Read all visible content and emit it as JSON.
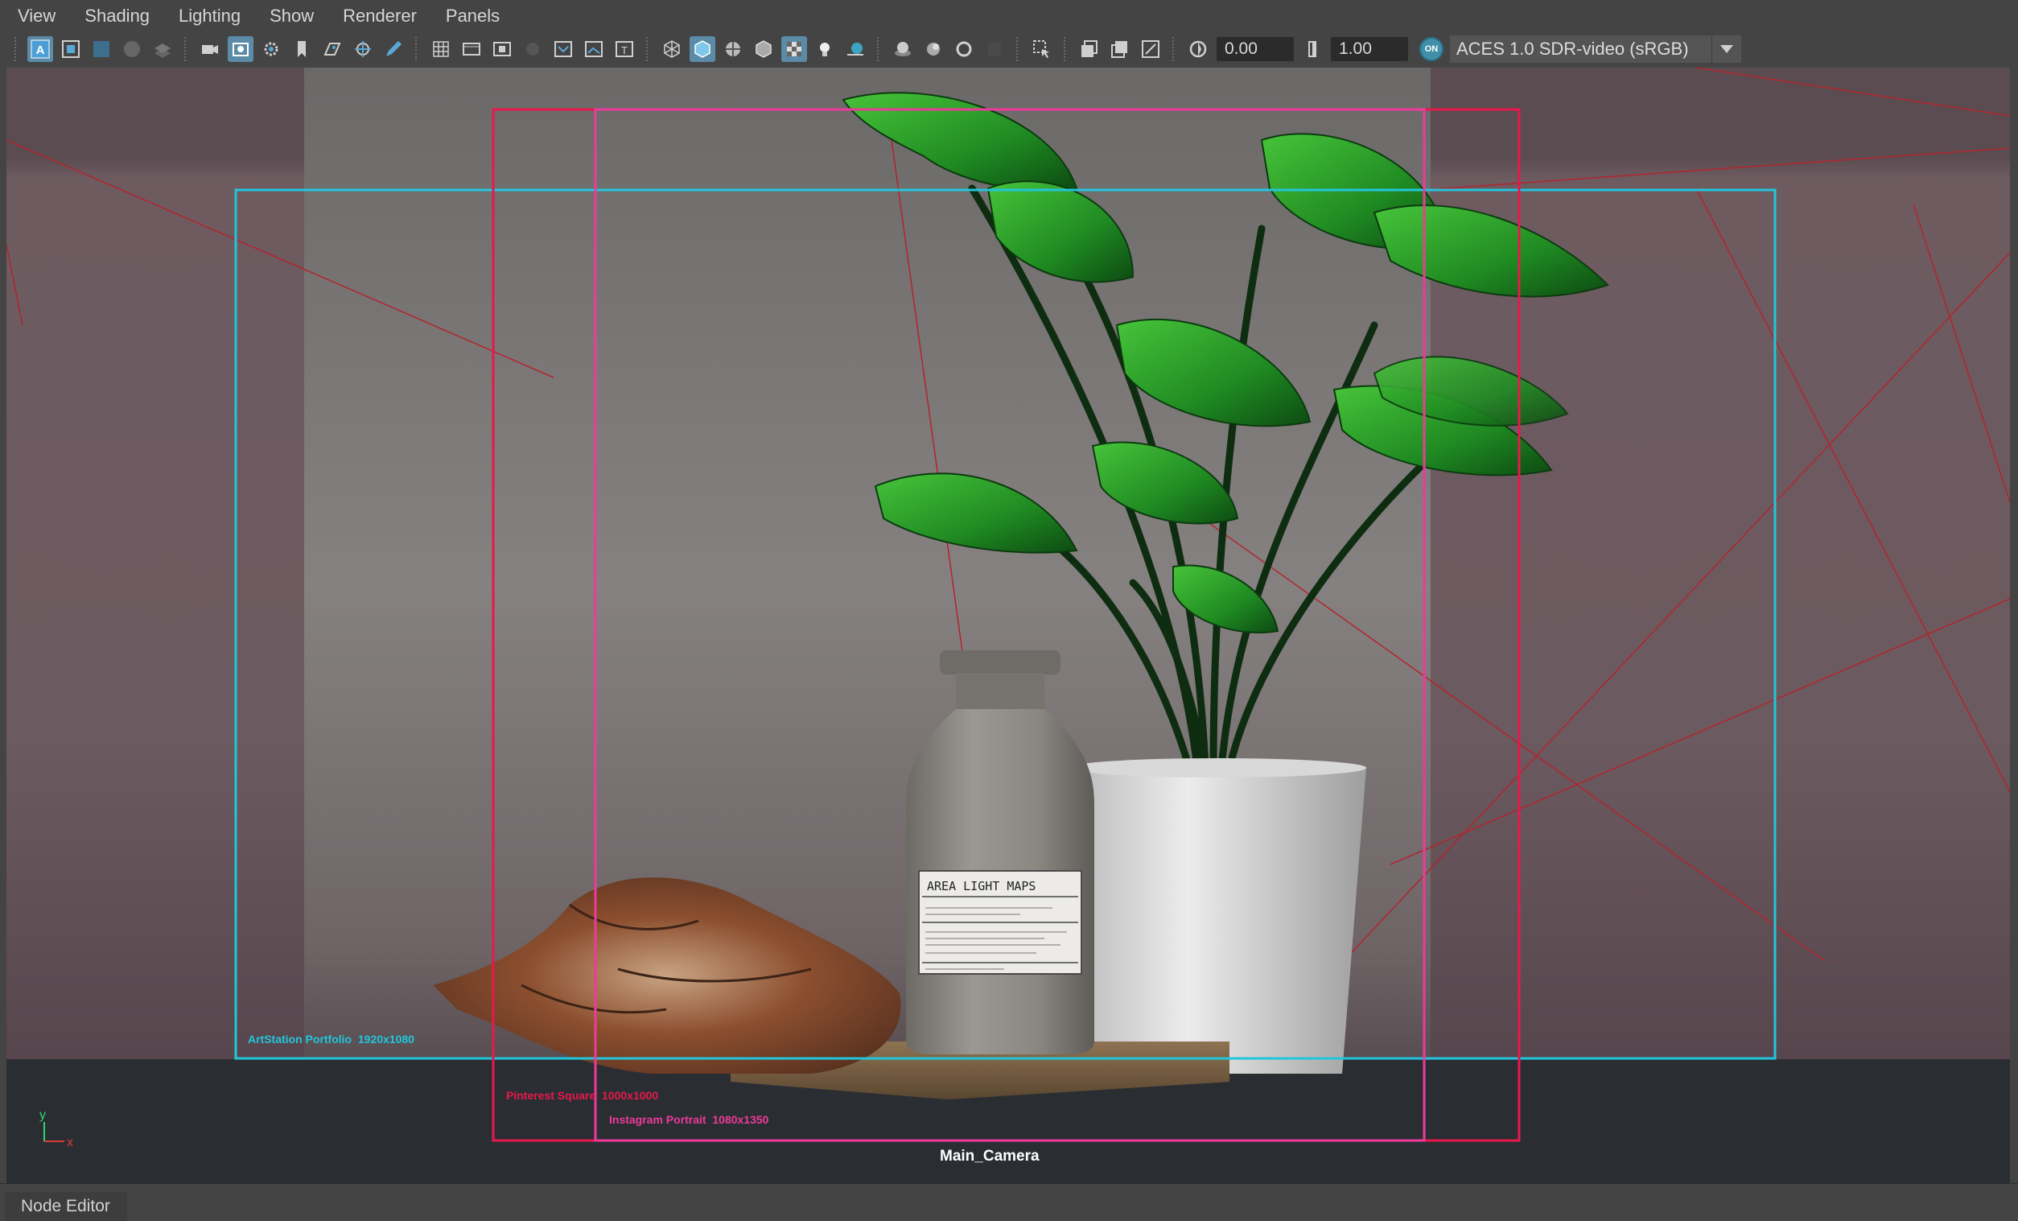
{
  "menu": {
    "items": [
      "View",
      "Shading",
      "Lighting",
      "Show",
      "Renderer",
      "Panels"
    ]
  },
  "toolbar": {
    "icons_group1": [
      "select-camera-icon",
      "camera-attributes-icon",
      "bookmarks-icon",
      "image-plane-icon",
      "2d-pan-zoom-icon"
    ],
    "icons_group2": [
      "grease-pencil-icon",
      "film-gate-icon",
      "resolution-gate-icon",
      "gate-mask-icon",
      "field-chart-icon",
      "safe-action-icon",
      "safe-title-icon"
    ],
    "icons_group3": [
      "wireframe-icon",
      "smooth-shade-icon",
      "textured-icon",
      "use-all-lights-icon",
      "shadows-icon",
      "screen-space-ao-icon",
      "motion-blur-icon",
      "anti-alias-icon"
    ],
    "exposure_value": "0.00",
    "gamma_value": "1.00",
    "color_mgmt_toggle": "ON",
    "view_transform": "ACES 1.0 SDR-video (sRGB)"
  },
  "viewport": {
    "gates": [
      {
        "label": "ArtStation Portfolio  1920x1080",
        "color": "#22c6dc"
      },
      {
        "label": "Pinterest Square  1000x1000",
        "color": "#e8184c"
      },
      {
        "label": "Instagram Portrait  1080x1350",
        "color": "#ee3a9a"
      }
    ],
    "bottle_label": {
      "title": "AREA LIGHT MAPS"
    },
    "axis": {
      "y": "y",
      "x": "x"
    },
    "camera_name": "Main_Camera"
  },
  "bottom_panel": {
    "tab_label": "Node Editor"
  },
  "colors": {
    "ui_bg": "#444444",
    "accent_blue": "#5b8ba6",
    "artstation_gate": "#22c6dc",
    "pinterest_gate": "#e8184c",
    "instagram_gate": "#ee3a9a"
  }
}
